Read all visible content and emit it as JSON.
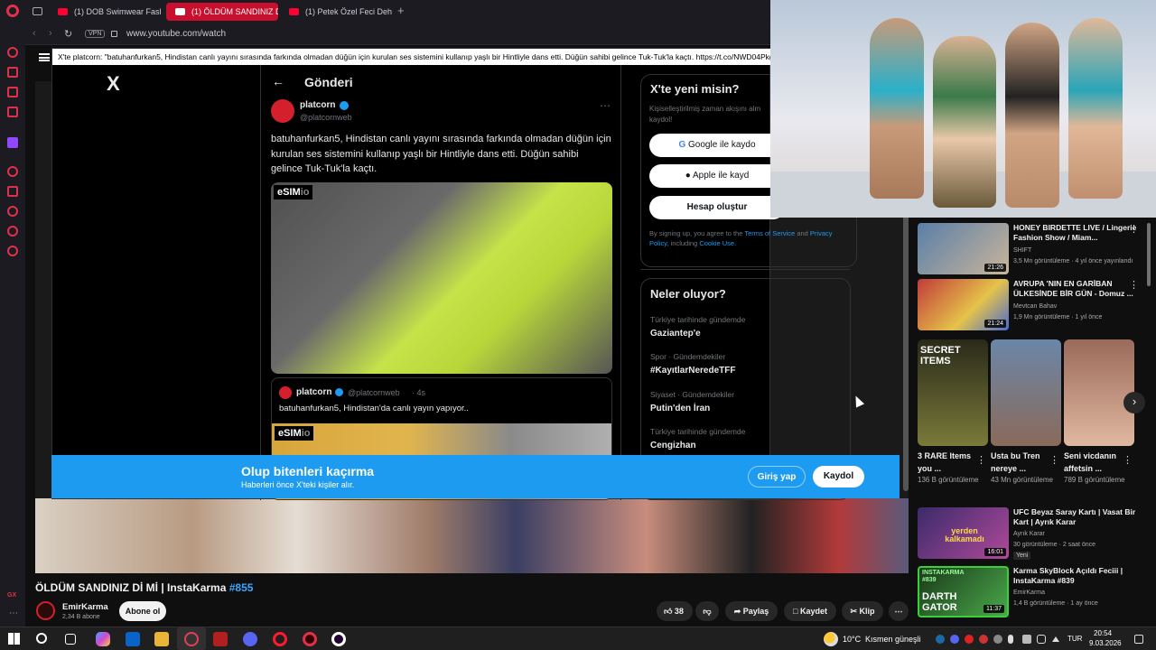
{
  "browser": {
    "tabs": [
      {
        "label": "(1) DOB Swimwear Fashio",
        "active": false
      },
      {
        "label": "(1) ÖLDÜM SANDINIZ Dİ M",
        "active": true
      },
      {
        "label": "(1) Petek Özel Feci Dehşet",
        "active": false
      }
    ],
    "vpn": "VPN",
    "url": "www.youtube.com/watch"
  },
  "x_window": {
    "title": "X'te platcorn: \"batuhanfurkan5, Hindistan canlı yayını sırasında farkında olmadan düğün için kurulan ses sistemini kullanıp yaşlı bir Hintliyle dans etti. Düğün sahibi gelince Tuk-Tuk'la kaçtı. https://t.co/NWD04PkgSb\" / X",
    "logo": "X",
    "header": "Gönderi",
    "post": {
      "author": "platcorn",
      "handle": "@platcornweb",
      "text": "batuhanfurkan5, Hindistan canlı yayını sırasında farkında olmadan düğün için kurulan ses sistemini kullanıp yaşlı bir Hintliyle dans etti. Düğün sahibi gelince Tuk-Tuk'la kaçtı.",
      "media_badge": "eSIM",
      "media_badge_suffix": "io",
      "quote": {
        "author": "platcorn",
        "handle": "@platcornweb",
        "age": "· 4s",
        "text": "batuhanfurkan5, Hindistan'da canlı yayın yapıyor..",
        "media_badge": "eSIM",
        "media_badge_suffix": "io"
      }
    },
    "signup": {
      "title": "X'te yeni misin?",
      "subtitle": "Kişiselleştirilmiş zaman akışını alm kaydol!",
      "google": "Google ile kaydo",
      "apple": "Apple ile kayd",
      "create": "Hesap oluştur",
      "legal_1": "By signing up, you agree to the",
      "tos": "Terms of Service",
      "and": "and",
      "privacy": "Privacy Policy",
      "including": ", including",
      "cookie": "Cookie Use."
    },
    "trends": {
      "title": "Neler oluyor?",
      "items": [
        {
          "category": "Türkiye tarihinde gündemde",
          "name": "Gaziantep'e"
        },
        {
          "category": "Spor · Gündemdekiler",
          "name": "#KayıtlarNeredeTFF"
        },
        {
          "category": "Siyaset · Gündemdekiler",
          "name": "Putin'den İran"
        },
        {
          "category": "Türkiye tarihinde gündemde",
          "name": "Cengizhan"
        }
      ]
    },
    "banner": {
      "title": "Olup bitenleri kaçırma",
      "subtitle": "Haberleri önce X'teki kişiler alır.",
      "login": "Giriş yap",
      "signup": "Kaydol"
    }
  },
  "video": {
    "title": "ÖLDÜM SANDINIZ Dİ Mİ | InstaKarma",
    "hashtag": "#855",
    "channel": "EmirKarma",
    "subscribers": "2,34 B abone",
    "subscribe": "Abone ol",
    "likes": "38",
    "share": "Paylaş",
    "save": "Kaydet",
    "clip": "Klip"
  },
  "recommendations": [
    {
      "title": "HONEY BIRDETTE LIVE / Lingerie Fashion Show / Miam...",
      "channel": "SHIFT",
      "meta": "3,5 Mn görüntüleme · 4 yıl önce yayınlandı",
      "duration": "21:26",
      "color": "#5a7fa8"
    },
    {
      "title": "AVRUPA 'NIN EN GARİBAN ÜLKESİNDE BİR GÜN - Domuz ...",
      "channel": "Mevtcan Bahav",
      "meta": "1,9 Mn görüntüleme · 1 yıl önce",
      "duration": "21:24",
      "color": "#c23a3a"
    }
  ],
  "shorts": [
    {
      "title": "3 RARE Items you ...",
      "views": "136 B görüntüleme",
      "color": "#4b4a2c",
      "label": "SECRET ITEMS"
    },
    {
      "title": "Usta bu Tren nereye ...",
      "views": "43 Mn görüntüleme",
      "color": "#6b86a8",
      "label": ""
    },
    {
      "title": "Seni vicdanın affetsin ...",
      "views": "789 B görüntüleme",
      "color": "#b58a74",
      "label": ""
    }
  ],
  "recommendations2": [
    {
      "title": "UFC Beyaz Saray Kartı | Vasat Bir Kart | Ayrık Karar",
      "channel": "Ayrık Karar",
      "meta": "30 görüntüleme · 2 saat önce",
      "badge": "Yeni",
      "duration": "16:01",
      "thumb_text": "yerden kalkamadı",
      "color": "#3a2a6a"
    },
    {
      "title": "Karma SkyBlock Açıldı Feciii | InstaKarma #839",
      "channel": "EmirKarma",
      "meta": "1,4 B görüntüleme · 1 ay önce",
      "duration": "11:37",
      "thumb_text": "DARTH GATOR",
      "thumb_top": "INSTAKARMA #839",
      "color": "#2a5a2a"
    }
  ],
  "taskbar": {
    "weather": "10°C",
    "weather_text": "Kısmen güneşli",
    "lang": "TUR",
    "time": "20:54",
    "date": "9.03.2026"
  }
}
